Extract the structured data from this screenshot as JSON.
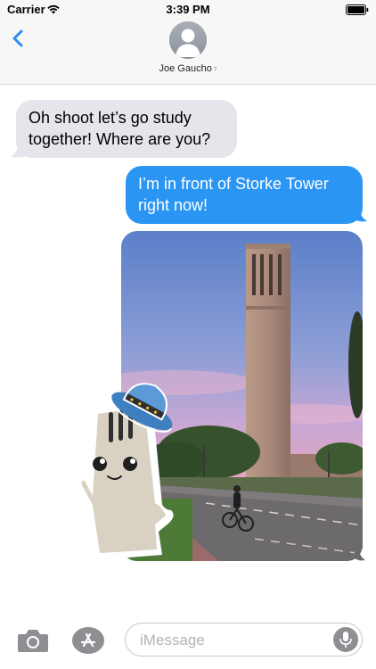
{
  "status_bar": {
    "carrier": "Carrier",
    "time": "3:39 PM",
    "wifi_icon": "wifi-icon",
    "battery_icon": "battery-icon"
  },
  "header": {
    "back_icon": "chevron-left-icon",
    "avatar_icon": "person-silhouette-icon",
    "contact_name": "Joe Gaucho",
    "contact_chevron": "›"
  },
  "conversation": {
    "incoming_text": "Oh shoot let’s go study together! Where are you?",
    "outgoing_text": "I’m in front of Storke Tower right now!",
    "photo_subject": "storke-tower-photo",
    "sticker": "fork-with-hat-sticker"
  },
  "input_bar": {
    "camera_icon": "camera-icon",
    "app_store_icon": "app-store-icon",
    "placeholder": "iMessage",
    "mic_icon": "microphone-icon"
  },
  "colors": {
    "accent": "#2b95f3",
    "incoming_bubble": "#e6e5eb",
    "header_bg": "#f7f7f7"
  }
}
